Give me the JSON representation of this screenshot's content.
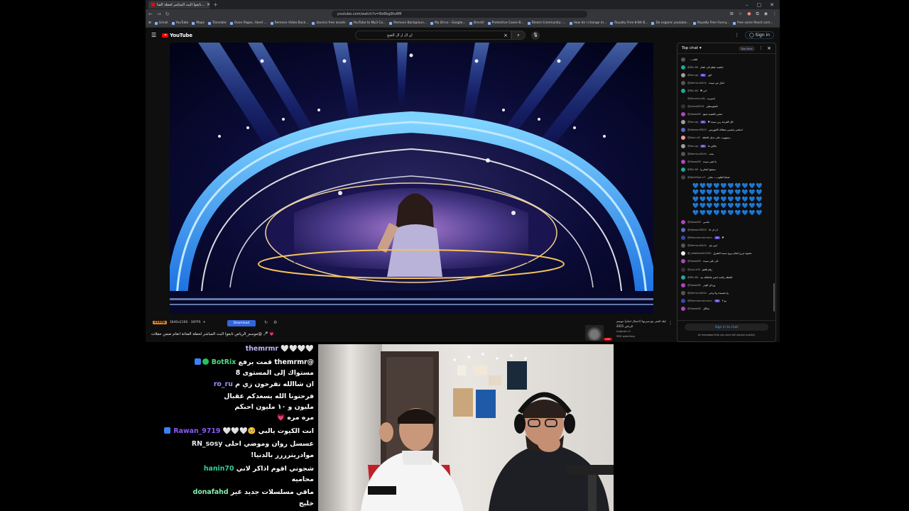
{
  "browser": {
    "tab_title": "تابعوا البث المباشر لحفلة الفنا...",
    "url": "youtube.com/watch?v=8x6bg9tu6M",
    "bookmarks": [
      "Gmail",
      "YouTube",
      "Maps",
      "Translate",
      "Ovon Pages, Hand ...",
      "Remove Video Back...",
      "davinci free assets",
      "YouTube to Mp3 Co...",
      "Remove Backgroun...",
      "My Drive - Google...",
      "DrevUI",
      "Protective Cases B...",
      "Steam Community :...",
      "How do I change m...",
      "Royalty Free 8-Bit B...",
      "Do organic youtube...",
      "Royalty Free Funny...",
      "free voice React com..."
    ]
  },
  "youtube": {
    "logo_text": "YouTube",
    "search_query": "ان ال ل ال الشح",
    "sign_in": "Sign in",
    "video": {
      "quality_badge": "2160p",
      "resolution_text": "3840x2160 · 30FPS",
      "download_label": "Download",
      "title": "💗 🎤 @موسم_الرياض تابعوا البث المباشر لحفلة الفنانة انغام ضمن حفلات"
    },
    "recommended": {
      "title": "ليلة العمر مع سيرتها (احتفال انغام) موسم",
      "subtitle": "الرياض 2025",
      "channel": "Angham ⊙",
      "watching": "990 watching",
      "live": "LIVE"
    }
  },
  "livechat": {
    "mode": "Top chat",
    "fans_pill": "Top Fans",
    "messages": [
      {
        "author": "",
        "text": "لقلب...",
        "color": "#555"
      },
      {
        "author": "@Rhi-80",
        "text": "حاضنه عظم الى انغام",
        "color": "#26a69a"
      },
      {
        "author": "@fox-qq",
        "badge": "41",
        "text": "اثق",
        "color": "#9e9e9e"
      },
      {
        "author": "@Alema-vBz2x",
        "text": "اتبال من سيده",
        "color": "#555"
      },
      {
        "author": "@Rhi-80",
        "text": "اتي 🎔",
        "color": "#26a69a"
      },
      {
        "author": "@Hamma-n8j",
        "text": "استريت",
        "color": "#111"
      },
      {
        "author": "@yonsa6254",
        "text": "المتوسطي",
        "color": "#333"
      },
      {
        "author": "@lioooo85",
        "text": "محبي العصيد منبج",
        "color": "#ab47bc"
      },
      {
        "author": "@fox-qq",
        "badge": "41",
        "text": "الل الفرحة ربي سيده 🎔",
        "color": "#9e9e9e"
      },
      {
        "author": "@abbasnf5820",
        "text": "اسلمي يابتسي منقاتك الليوريس",
        "color": "#5c6bc0"
      },
      {
        "author": "@faya-cj5",
        "text": "ربنيوووب على ساي الحفلة",
        "color": "#ef9a9a"
      },
      {
        "author": "@fox-qq",
        "badge": "41",
        "text": "عالاى ما",
        "color": "#9e9e9e"
      },
      {
        "author": "@Alema-vBz2x",
        "text": "يحب",
        "color": "#555"
      },
      {
        "author": "@lioooo85",
        "text": "با انقي سيده",
        "color": "#ab47bc"
      },
      {
        "author": "@Rhi-80",
        "text": "سمعوا انغام وا",
        "color": "#26a69a"
      },
      {
        "author": "@Abdrilloa-n7",
        "text": "تحيانا القلوب... نخلي",
        "color": "#444"
      }
    ],
    "hearts_count": 50,
    "messages_after": [
      {
        "author": "@lioooo85",
        "text": "ماسي",
        "color": "#ab47bc"
      },
      {
        "author": "@abbasnf5820",
        "text": "ان ان انا",
        "color": "#5c6bc0"
      },
      {
        "author": "@Mmmmmmmmm",
        "badge": "43",
        "text": "🎔",
        "color": "#3949ab"
      },
      {
        "author": "@Alema-vBz2x",
        "text": "ابين نيل",
        "color": "#555"
      },
      {
        "author": "@_abdelkabir2200",
        "text": "محبوه نزرح انغام بروح سيده الشرق",
        "color": "#eeeeee"
      },
      {
        "author": "@lioooo85",
        "text": "الى بالي سيده",
        "color": "#ab47bc"
      },
      {
        "author": "@LoLi-n5t",
        "text": "رقم قلمو",
        "color": "#333"
      },
      {
        "author": "@Rhi-80",
        "text": "الحفلة رائعت اتمن ماشالله بيه",
        "color": "#26a69a"
      },
      {
        "author": "@lioooo85",
        "text": "ورداي الودر",
        "color": "#ab47bc"
      },
      {
        "author": "@Alema-vBz2x",
        "text": "وا بعسيده ولا وحي",
        "color": "#555"
      },
      {
        "author": "@Mmmmmmmmm",
        "badge": "43",
        "text": "نو ٣",
        "color": "#3949ab"
      },
      {
        "author": "@lioooo85",
        "text": "يحاكل",
        "color": "#ab47bc"
      }
    ],
    "signin_prompt": "Sign in to chat",
    "footer_note": "All messages that you send will appear publicly"
  },
  "stream_chat": [
    {
      "user": "themrmr",
      "color": "#c8b5ff",
      "text": "🤍🤍🤍🤍",
      "badges": []
    },
    {
      "user": "BotRix",
      "color": "#4ade80",
      "text": "@themrmr قمت برفع",
      "badges": [
        "blue",
        "green"
      ]
    },
    {
      "user": "",
      "color": "#fff",
      "text": "مستواك إلى المستوى 8",
      "badges": []
    },
    {
      "user": "ro_ru",
      "color": "#a78bfa",
      "text": "ان شاالله تفرحون زي م",
      "badges": []
    },
    {
      "user": "",
      "color": "#fff",
      "text": "فرحتونا الله يسعدكم عقبال",
      "badges": []
    },
    {
      "user": "",
      "color": "#fff",
      "text": "مليون و ١٠ مليون احبكم",
      "badges": []
    },
    {
      "user": "",
      "color": "#fff",
      "text": "مره مره 💗",
      "badges": []
    },
    {
      "user": "Rawan_9719",
      "color": "#8b5cf6",
      "text": "انت الكيوت يالبي 🥺🤍🤍🤍",
      "badges": [
        "blue"
      ]
    },
    {
      "user": "RN_sosy",
      "color": "#e5e7eb",
      "text": "عسسل روان وموضي احلى",
      "badges": []
    },
    {
      "user": "",
      "color": "#fff",
      "text": "موادريترررر بالدنيا!",
      "badges": []
    },
    {
      "user": "hanin70",
      "color": "#34d399",
      "text": "شجوني اقوم اذاكر لاني",
      "badges": []
    },
    {
      "user": "",
      "color": "#fff",
      "text": "محاميه",
      "badges": []
    },
    {
      "user": "donafahd",
      "color": "#86efac",
      "text": "ماقي مسلسلات جديد غير",
      "badges": []
    },
    {
      "user": "",
      "color": "#fff",
      "text": "خليج",
      "badges": []
    }
  ]
}
